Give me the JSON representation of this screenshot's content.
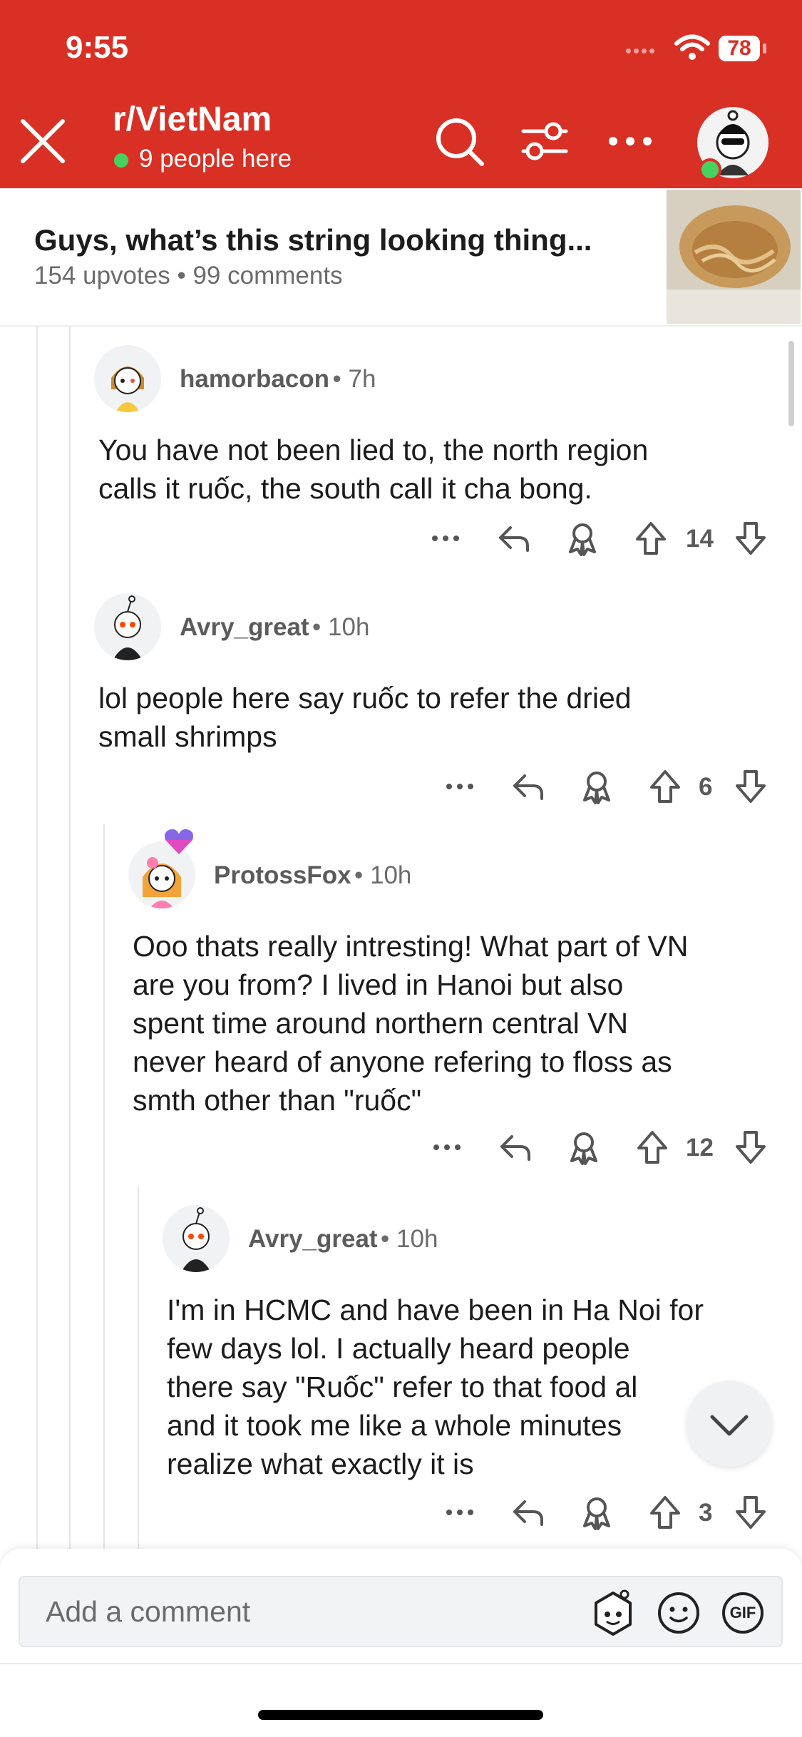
{
  "status_bar": {
    "time": "9:55",
    "battery": "78"
  },
  "header": {
    "subreddit": "r/VietNam",
    "online_count": "9 people here"
  },
  "post": {
    "title": "Guys, what’s this string looking thing...",
    "upvotes": "154 upvotes",
    "separator": "•",
    "comments": "99 comments"
  },
  "comments": [
    {
      "author": "hamorbacon",
      "time": "7h",
      "body_lines": [
        "You have not been lied to, the north region",
        "calls it ruốc, the south call it cha bong."
      ],
      "votes": "14"
    },
    {
      "author": "Avry_great",
      "time": "10h",
      "body_lines": [
        "lol people here say ruốc to refer the dried",
        "small shrimps"
      ],
      "votes": "6"
    },
    {
      "author": "ProtossFox",
      "time": "10h",
      "body_lines": [
        "Ooo thats really intresting! What part of VN",
        "are you from? I lived in Hanoi but also",
        "spent time around northern central VN",
        "never heard of anyone refering to floss as",
        "smth other than \"ruốc\""
      ],
      "votes": "12"
    },
    {
      "author": "Avry_great",
      "time": "10h",
      "body_lines": [
        "I'm in HCMC and have been in Ha Noi for",
        "few days lol. I actually heard people",
        "there say \"Ruốc\" refer to that food al",
        "and it took me like a whole minutes",
        "realize what exactly it is"
      ],
      "votes": "3"
    }
  ],
  "composer": {
    "placeholder": "Add a comment",
    "gif_label": "GIF"
  },
  "colors": {
    "brand_red": "#d93025",
    "online_green": "#46d160"
  }
}
